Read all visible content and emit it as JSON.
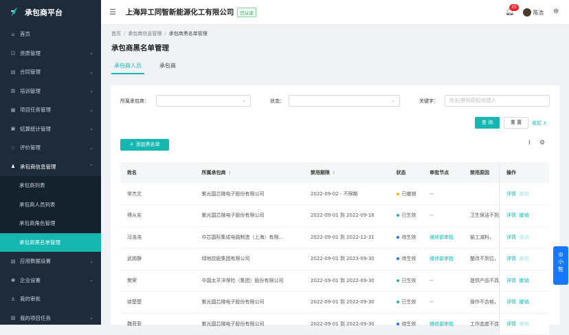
{
  "sidebar": {
    "logo": "承包商平台",
    "items": [
      {
        "icon": "⌂",
        "label": "首页",
        "caret": ""
      },
      {
        "icon": "◫",
        "label": "资质管理",
        "caret": "⌄"
      },
      {
        "icon": "▤",
        "label": "合同管理",
        "caret": "⌄"
      },
      {
        "icon": "▥",
        "label": "培训管理",
        "caret": "⌄"
      },
      {
        "icon": "▦",
        "label": "项目任务管理",
        "caret": "⌄"
      },
      {
        "icon": "▣",
        "label": "结算统计管理",
        "caret": "⌄"
      },
      {
        "icon": "☆",
        "label": "评价管理",
        "caret": "⌄"
      },
      {
        "icon": "♟",
        "label": "承包商信息管理",
        "caret": "⌃"
      }
    ],
    "sub_items": [
      "承包商列表",
      "承包商人员列表",
      "承包商角色管理",
      "承包商黑名单管理"
    ],
    "items_after": [
      {
        "icon": "▧",
        "label": "应用数据设置",
        "caret": "⌄"
      },
      {
        "icon": "◉",
        "label": "企业设置",
        "caret": "⌄"
      },
      {
        "icon": "♙",
        "label": "我的审批",
        "caret": ""
      },
      {
        "icon": "▨",
        "label": "我的项目任务",
        "caret": "⌄"
      }
    ]
  },
  "header": {
    "company": "上海异工同智新能源化工有限公司",
    "verified": "已认证",
    "badge": "25",
    "username": "陈浩"
  },
  "breadcrumb": [
    "首页",
    "承包商信息管理",
    "承包商黑名单管理"
  ],
  "page_title": "承包商黑名单管理",
  "tabs": [
    "承包商人员",
    "承包商"
  ],
  "filters": {
    "contractor_label": "所属承包商：",
    "status_label": "状态：",
    "keyword_label": "关键字：",
    "keyword_placeholder": "姓名/禁用原因/创建人",
    "search": "查 询",
    "reset": "重 置",
    "collapse": "收起 ∧"
  },
  "add_button": "＋ 添加黑名单",
  "table": {
    "headers": [
      "姓名",
      "所属承包商",
      "禁用期限",
      "状态",
      "审批节点",
      "禁用原因",
      "操作"
    ],
    "rows": [
      {
        "name": "常杰文",
        "company": "紫光国芯微电子股份有限公司",
        "period": "2022-09-02 - 不限期",
        "status": "已撤销",
        "status_color": "#f5b800",
        "node": "--",
        "node_link": false,
        "reason": "",
        "detail": "详情",
        "revoke": "撤销",
        "revoke_active": false
      },
      {
        "name": "傅从安",
        "company": "紫光国芯微电子股份有限公司",
        "period": "2022-09-01 到 2022-09-16",
        "status": "已生效",
        "status_color": "#16b7b0",
        "node": "--",
        "node_link": false,
        "reason": "卫生保洁不到",
        "detail": "详情",
        "revoke": "撤销",
        "revoke_active": true
      },
      {
        "name": "冯浩浩",
        "company": "中芯国际集成电路制造（上海）有限...",
        "period": "2022-09-01 到 2022-12-31",
        "status": "待生效",
        "status_color": "#1677ff",
        "node": "维修部审批",
        "node_link": true,
        "reason": "偷工减料，",
        "detail": "详情",
        "revoke": "撤销",
        "revoke_active": false
      },
      {
        "name": "武婉静",
        "company": "绿地控股集团有限公司",
        "period": "2022-09-01 到 2023-09-30",
        "status": "待生效",
        "status_color": "#1677ff",
        "node": "维修部审批",
        "node_link": true,
        "reason": "整改不到位，",
        "detail": "详情",
        "revoke": "撤销",
        "revoke_active": false
      },
      {
        "name": "樊荣",
        "company": "中国太平洋保险（集团）股份有限公司",
        "period": "2022-09-01 到 2022-09-30",
        "status": "已生效",
        "status_color": "#16b7b0",
        "node": "--",
        "node_link": false,
        "reason": "提供产品不具",
        "detail": "详情",
        "revoke": "撤销",
        "revoke_active": true
      },
      {
        "name": "徐楚楚",
        "company": "紫光国芯微电子股份有限公司",
        "period": "2022-09-01 到 2022-09-30",
        "status": "已生效",
        "status_color": "#16b7b0",
        "node": "--",
        "node_link": false,
        "reason": "操作不合格，",
        "detail": "详情",
        "revoke": "撤销",
        "revoke_active": true
      },
      {
        "name": "魏菲菲",
        "company": "紫光国芯微电子股份有限公司",
        "period": "2022-09-01 到 2022-09-30",
        "status": "待生效",
        "status_color": "#1677ff",
        "node": "维修部审批",
        "node_link": true,
        "reason": "工作态度不佳",
        "detail": "详情",
        "revoke": "撤销",
        "revoke_active": false
      }
    ]
  },
  "float_widget": [
    "小",
    "智"
  ]
}
